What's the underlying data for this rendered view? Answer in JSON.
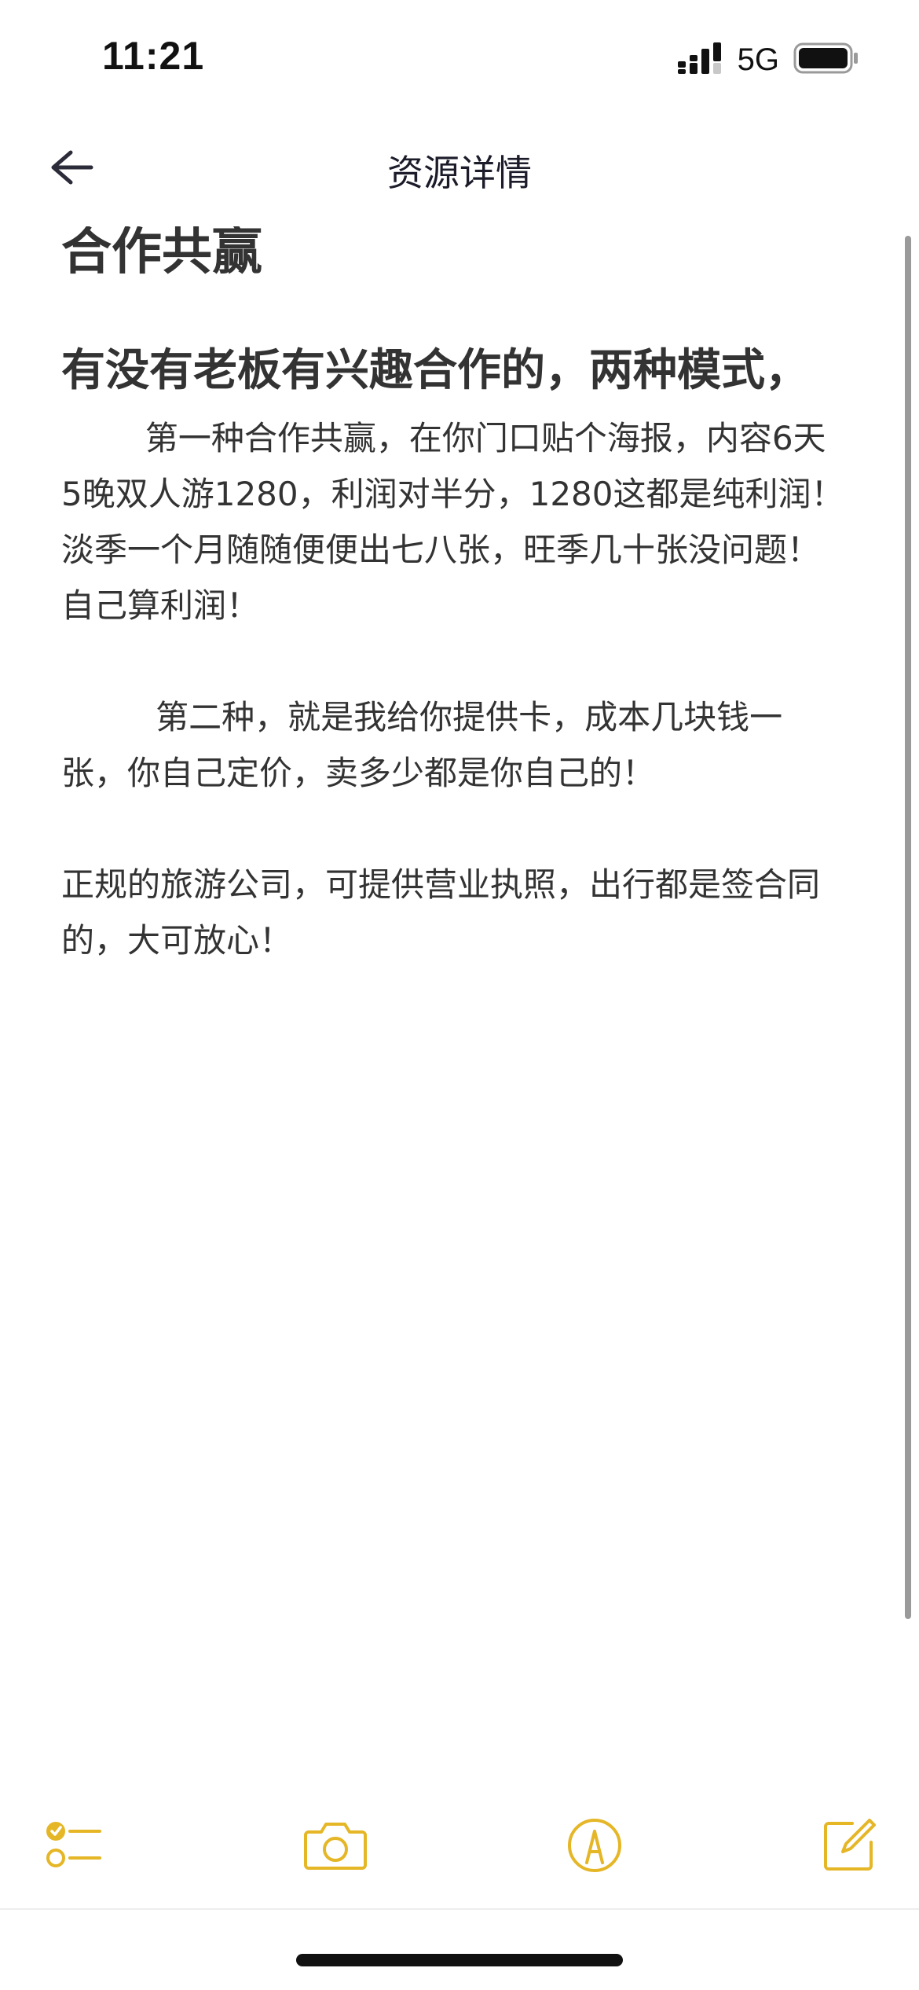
{
  "status_bar": {
    "time": "11:21",
    "network": "5G",
    "icons": [
      "signal-icon",
      "battery-icon"
    ]
  },
  "nav": {
    "title": "资源详情",
    "back_icon": "arrow-left-icon"
  },
  "article": {
    "title": "合作共赢",
    "heading": "有没有老板有兴趣合作的，两种模式，",
    "paragraphs": [
      "        第一种合作共赢，在你门口贴个海报，内容6天5晚双人游1280，利润对半分，1280这都是纯利润！淡季一个月随随便便出七八张，旺季几十张没问题！自己算利润！",
      "         第二种，就是我给你提供卡，成本几块钱一张，你自己定价，卖多少都是你自己的！",
      "正规的旅游公司，可提供营业执照，出行都是签合同的，大可放心！"
    ]
  },
  "toolbar": {
    "accent_color": "#E5B626",
    "icons": [
      "checklist-icon",
      "camera-icon",
      "markup-icon",
      "compose-icon"
    ]
  }
}
